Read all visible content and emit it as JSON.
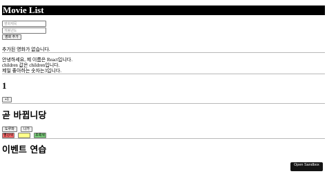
{
  "header": {
    "title": "Movie List"
  },
  "form": {
    "title_placeholder": "영화제목",
    "year_placeholder": "개봉년도",
    "add_label": "영화 추가",
    "empty_message": "추가된 영화가 없습니다."
  },
  "greeting": {
    "line1": "안녕하세요, 제 이름은 React입니다.",
    "line2": "children 값은 children입니다.",
    "line3": "제일 좋아하는 숫자는3입니다."
  },
  "counter": {
    "value": "1",
    "plus_label": "+1"
  },
  "status_section": {
    "heading": "곧 바뀝니당",
    "enter_label": "도루와",
    "leave_label": "나가",
    "red_label": "빨강색",
    "yellow_label": "",
    "green_label": "초록색",
    "colors": {
      "red": "#ff6b6b",
      "yellow": "#ffff8a",
      "green": "#7cd17c"
    }
  },
  "event_section": {
    "heading": "이벤트 연습"
  },
  "sandbox": {
    "label": "Open Sandbox"
  }
}
